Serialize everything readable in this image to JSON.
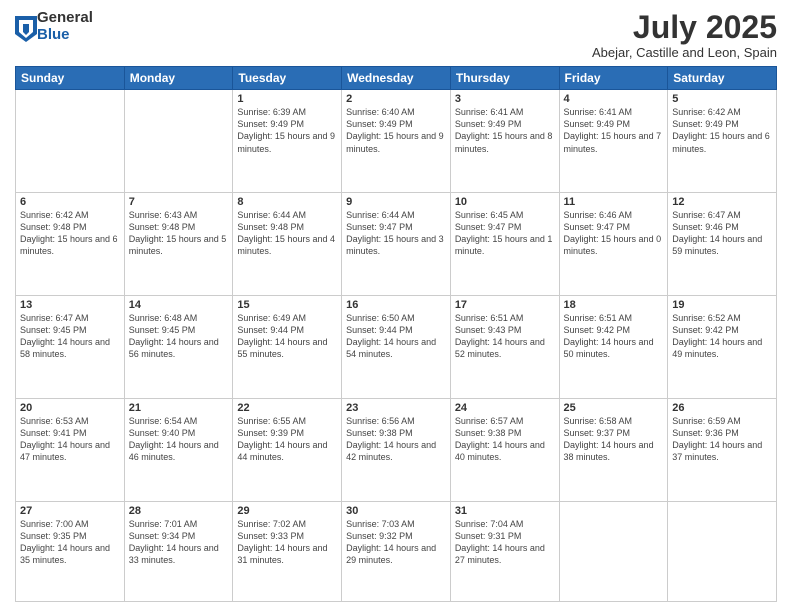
{
  "logo": {
    "general": "General",
    "blue": "Blue"
  },
  "title": "July 2025",
  "location": "Abejar, Castille and Leon, Spain",
  "weekdays": [
    "Sunday",
    "Monday",
    "Tuesday",
    "Wednesday",
    "Thursday",
    "Friday",
    "Saturday"
  ],
  "weeks": [
    [
      {
        "day": "",
        "sunrise": "",
        "sunset": "",
        "daylight": ""
      },
      {
        "day": "",
        "sunrise": "",
        "sunset": "",
        "daylight": ""
      },
      {
        "day": "1",
        "sunrise": "Sunrise: 6:39 AM",
        "sunset": "Sunset: 9:49 PM",
        "daylight": "Daylight: 15 hours and 9 minutes."
      },
      {
        "day": "2",
        "sunrise": "Sunrise: 6:40 AM",
        "sunset": "Sunset: 9:49 PM",
        "daylight": "Daylight: 15 hours and 9 minutes."
      },
      {
        "day": "3",
        "sunrise": "Sunrise: 6:41 AM",
        "sunset": "Sunset: 9:49 PM",
        "daylight": "Daylight: 15 hours and 8 minutes."
      },
      {
        "day": "4",
        "sunrise": "Sunrise: 6:41 AM",
        "sunset": "Sunset: 9:49 PM",
        "daylight": "Daylight: 15 hours and 7 minutes."
      },
      {
        "day": "5",
        "sunrise": "Sunrise: 6:42 AM",
        "sunset": "Sunset: 9:49 PM",
        "daylight": "Daylight: 15 hours and 6 minutes."
      }
    ],
    [
      {
        "day": "6",
        "sunrise": "Sunrise: 6:42 AM",
        "sunset": "Sunset: 9:48 PM",
        "daylight": "Daylight: 15 hours and 6 minutes."
      },
      {
        "day": "7",
        "sunrise": "Sunrise: 6:43 AM",
        "sunset": "Sunset: 9:48 PM",
        "daylight": "Daylight: 15 hours and 5 minutes."
      },
      {
        "day": "8",
        "sunrise": "Sunrise: 6:44 AM",
        "sunset": "Sunset: 9:48 PM",
        "daylight": "Daylight: 15 hours and 4 minutes."
      },
      {
        "day": "9",
        "sunrise": "Sunrise: 6:44 AM",
        "sunset": "Sunset: 9:47 PM",
        "daylight": "Daylight: 15 hours and 3 minutes."
      },
      {
        "day": "10",
        "sunrise": "Sunrise: 6:45 AM",
        "sunset": "Sunset: 9:47 PM",
        "daylight": "Daylight: 15 hours and 1 minute."
      },
      {
        "day": "11",
        "sunrise": "Sunrise: 6:46 AM",
        "sunset": "Sunset: 9:47 PM",
        "daylight": "Daylight: 15 hours and 0 minutes."
      },
      {
        "day": "12",
        "sunrise": "Sunrise: 6:47 AM",
        "sunset": "Sunset: 9:46 PM",
        "daylight": "Daylight: 14 hours and 59 minutes."
      }
    ],
    [
      {
        "day": "13",
        "sunrise": "Sunrise: 6:47 AM",
        "sunset": "Sunset: 9:45 PM",
        "daylight": "Daylight: 14 hours and 58 minutes."
      },
      {
        "day": "14",
        "sunrise": "Sunrise: 6:48 AM",
        "sunset": "Sunset: 9:45 PM",
        "daylight": "Daylight: 14 hours and 56 minutes."
      },
      {
        "day": "15",
        "sunrise": "Sunrise: 6:49 AM",
        "sunset": "Sunset: 9:44 PM",
        "daylight": "Daylight: 14 hours and 55 minutes."
      },
      {
        "day": "16",
        "sunrise": "Sunrise: 6:50 AM",
        "sunset": "Sunset: 9:44 PM",
        "daylight": "Daylight: 14 hours and 54 minutes."
      },
      {
        "day": "17",
        "sunrise": "Sunrise: 6:51 AM",
        "sunset": "Sunset: 9:43 PM",
        "daylight": "Daylight: 14 hours and 52 minutes."
      },
      {
        "day": "18",
        "sunrise": "Sunrise: 6:51 AM",
        "sunset": "Sunset: 9:42 PM",
        "daylight": "Daylight: 14 hours and 50 minutes."
      },
      {
        "day": "19",
        "sunrise": "Sunrise: 6:52 AM",
        "sunset": "Sunset: 9:42 PM",
        "daylight": "Daylight: 14 hours and 49 minutes."
      }
    ],
    [
      {
        "day": "20",
        "sunrise": "Sunrise: 6:53 AM",
        "sunset": "Sunset: 9:41 PM",
        "daylight": "Daylight: 14 hours and 47 minutes."
      },
      {
        "day": "21",
        "sunrise": "Sunrise: 6:54 AM",
        "sunset": "Sunset: 9:40 PM",
        "daylight": "Daylight: 14 hours and 46 minutes."
      },
      {
        "day": "22",
        "sunrise": "Sunrise: 6:55 AM",
        "sunset": "Sunset: 9:39 PM",
        "daylight": "Daylight: 14 hours and 44 minutes."
      },
      {
        "day": "23",
        "sunrise": "Sunrise: 6:56 AM",
        "sunset": "Sunset: 9:38 PM",
        "daylight": "Daylight: 14 hours and 42 minutes."
      },
      {
        "day": "24",
        "sunrise": "Sunrise: 6:57 AM",
        "sunset": "Sunset: 9:38 PM",
        "daylight": "Daylight: 14 hours and 40 minutes."
      },
      {
        "day": "25",
        "sunrise": "Sunrise: 6:58 AM",
        "sunset": "Sunset: 9:37 PM",
        "daylight": "Daylight: 14 hours and 38 minutes."
      },
      {
        "day": "26",
        "sunrise": "Sunrise: 6:59 AM",
        "sunset": "Sunset: 9:36 PM",
        "daylight": "Daylight: 14 hours and 37 minutes."
      }
    ],
    [
      {
        "day": "27",
        "sunrise": "Sunrise: 7:00 AM",
        "sunset": "Sunset: 9:35 PM",
        "daylight": "Daylight: 14 hours and 35 minutes."
      },
      {
        "day": "28",
        "sunrise": "Sunrise: 7:01 AM",
        "sunset": "Sunset: 9:34 PM",
        "daylight": "Daylight: 14 hours and 33 minutes."
      },
      {
        "day": "29",
        "sunrise": "Sunrise: 7:02 AM",
        "sunset": "Sunset: 9:33 PM",
        "daylight": "Daylight: 14 hours and 31 minutes."
      },
      {
        "day": "30",
        "sunrise": "Sunrise: 7:03 AM",
        "sunset": "Sunset: 9:32 PM",
        "daylight": "Daylight: 14 hours and 29 minutes."
      },
      {
        "day": "31",
        "sunrise": "Sunrise: 7:04 AM",
        "sunset": "Sunset: 9:31 PM",
        "daylight": "Daylight: 14 hours and 27 minutes."
      },
      {
        "day": "",
        "sunrise": "",
        "sunset": "",
        "daylight": ""
      },
      {
        "day": "",
        "sunrise": "",
        "sunset": "",
        "daylight": ""
      }
    ]
  ]
}
